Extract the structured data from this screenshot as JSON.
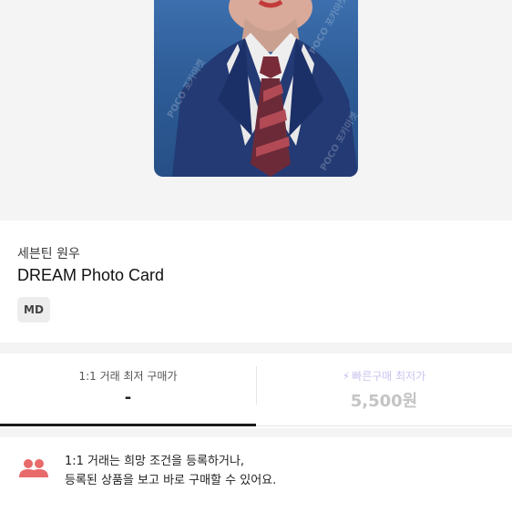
{
  "product": {
    "artist": "세븐틴 원우",
    "title": "DREAM Photo Card",
    "tag": "MD"
  },
  "prices": {
    "direct_label": "1:1 거래 최저 구매가",
    "direct_value": "-",
    "quick_label": "빠른구매 최저가",
    "quick_value": "5,500원"
  },
  "notice": {
    "line1": "1:1 거래는 희망 조건을 등록하거나,",
    "line2": "등록된 상품을 보고 바로 구매할 수 있어요."
  },
  "icons": {
    "notice": "users-icon",
    "quick": "lightning-icon"
  },
  "colors": {
    "accent_quick": "#c6bff0",
    "notice_icon": "#e86a6a"
  }
}
